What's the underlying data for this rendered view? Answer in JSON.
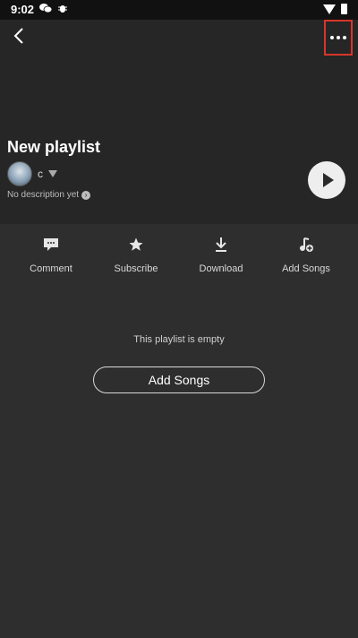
{
  "status_bar": {
    "time": "9:02",
    "left_icons": [
      "wechat-icon",
      "bug-icon"
    ]
  },
  "header": {
    "title": "New playlist",
    "owner_name": "c",
    "description": "No description yet",
    "description_chevron": "›"
  },
  "actions": [
    {
      "label": "Comment",
      "icon": "comment-icon"
    },
    {
      "label": "Subscribe",
      "icon": "star-icon"
    },
    {
      "label": "Download",
      "icon": "download-icon"
    },
    {
      "label": "Add Songs",
      "icon": "add-music-icon"
    }
  ],
  "empty_state": {
    "message": "This playlist is empty",
    "button_label": "Add Songs"
  },
  "colors": {
    "background": "#2e2e2e",
    "header_bg": "#262626",
    "highlight": "#d7362a"
  }
}
